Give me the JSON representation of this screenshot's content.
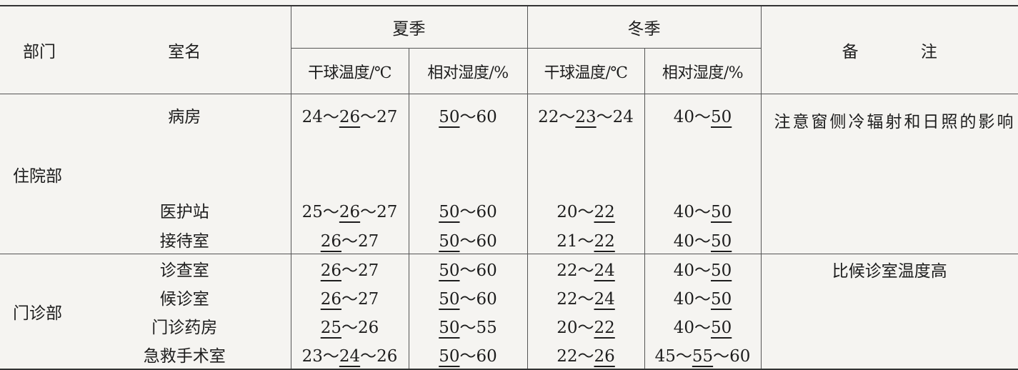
{
  "headers": {
    "dept": "部门",
    "room": "室名",
    "summer": "夏季",
    "winter": "冬季",
    "remark": "备 注",
    "dry_bulb": "干球温度/℃",
    "rh": "相对湿度/%"
  },
  "sections": [
    {
      "dept": "住院部",
      "rows": [
        {
          "room": "病房",
          "s_t": [
            "24～",
            "26",
            "～27"
          ],
          "s_h": [
            "",
            "50",
            "～60"
          ],
          "w_t": [
            "22～",
            "23",
            "～24"
          ],
          "w_h": [
            "40～",
            "50",
            ""
          ]
        },
        {
          "room": "医护站",
          "s_t": [
            "25～",
            "26",
            "～27"
          ],
          "s_h": [
            "",
            "50",
            "～60"
          ],
          "w_t": [
            "20～",
            "22",
            ""
          ],
          "w_h": [
            "40～",
            "50",
            ""
          ]
        },
        {
          "room": "接待室",
          "s_t": [
            "",
            "26",
            "～27"
          ],
          "s_h": [
            "",
            "50",
            "～60"
          ],
          "w_t": [
            "21～",
            "22",
            ""
          ],
          "w_h": [
            "40～",
            "50",
            ""
          ]
        }
      ],
      "remark": "注意窗侧冷辐射和日照的影响"
    },
    {
      "dept": "门诊部",
      "rows": [
        {
          "room": "诊查室",
          "s_t": [
            "",
            "26",
            "～27"
          ],
          "s_h": [
            "",
            "50",
            "～60"
          ],
          "w_t": [
            "22～",
            "24",
            ""
          ],
          "w_h": [
            "40～",
            "50",
            ""
          ]
        },
        {
          "room": "候诊室",
          "s_t": [
            "",
            "26",
            "～27"
          ],
          "s_h": [
            "",
            "50",
            "～60"
          ],
          "w_t": [
            "22～",
            "24",
            ""
          ],
          "w_h": [
            "40～",
            "50",
            ""
          ]
        },
        {
          "room": "门诊药房",
          "s_t": [
            "",
            "25",
            "～26"
          ],
          "s_h": [
            "",
            "50",
            "～55"
          ],
          "w_t": [
            "20～",
            "22",
            ""
          ],
          "w_h": [
            "40～",
            "50",
            ""
          ]
        },
        {
          "room": "急救手术室",
          "s_t": [
            "23～",
            "24",
            "～26"
          ],
          "s_h": [
            "",
            "50",
            "～60"
          ],
          "w_t": [
            "22～",
            "26",
            ""
          ],
          "w_h": [
            "45～",
            "55",
            "～60"
          ]
        }
      ],
      "remark": "比候诊室温度高"
    }
  ]
}
